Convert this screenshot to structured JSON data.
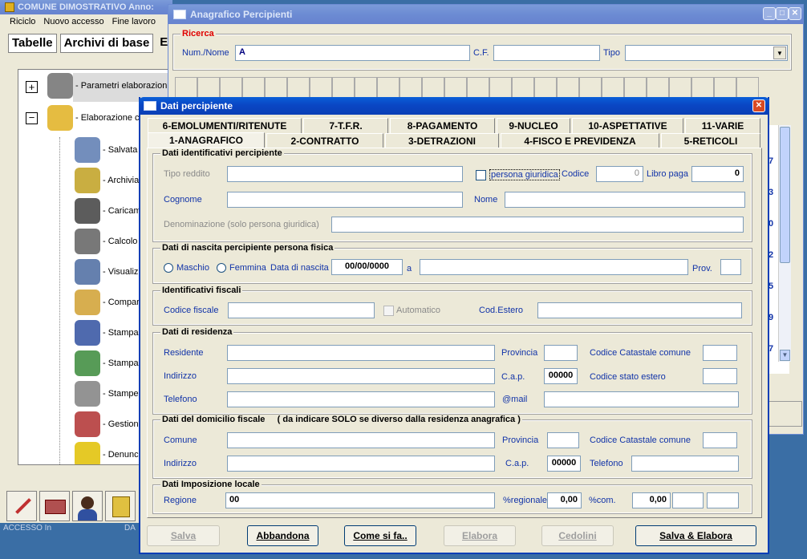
{
  "main_window": {
    "title": "COMUNE DIMOSTRATIVO  Anno:",
    "menu": [
      "Riciclo",
      "Nuovo accesso",
      "Fine lavoro"
    ],
    "tabs": [
      "Tabelle",
      "Archivi di base",
      "E"
    ],
    "tree": [
      {
        "label": "- Parametri elaborazioni",
        "icon": "gears-icon"
      },
      {
        "label": "- Elaborazione c",
        "icon": "calculator-icon"
      },
      {
        "label": "- Salvata",
        "icon": "disk-drive-icon"
      },
      {
        "label": "- Archivia",
        "icon": "keys-icon"
      },
      {
        "label": "- Caricam",
        "icon": "pen-icon"
      },
      {
        "label": "- Calcolo",
        "icon": "gear-icon"
      },
      {
        "label": "- Visualiz",
        "icon": "magnifier-document-icon"
      },
      {
        "label": "- Compar",
        "icon": "hand-documents-icon"
      },
      {
        "label": "- Stampa",
        "icon": "report-icon"
      },
      {
        "label": "- Stampa",
        "icon": "emblem-icon"
      },
      {
        "label": "- Stampe",
        "icon": "printer-icon"
      },
      {
        "label": "- Gestion",
        "icon": "checklist-icon"
      },
      {
        "label": "- Denunc",
        "icon": "pacman-icon"
      }
    ],
    "status": "ACCESSO In",
    "status2": "DA"
  },
  "anagrafico": {
    "title": "Anagrafico Percipienti",
    "ricerca_legend": "Ricerca",
    "num_nome_label": "Num./Nome",
    "num_nome_value": "A",
    "cf_label": "C.F.",
    "tipo_label": "Tipo",
    "side_numbers": [
      "7",
      "3",
      "0",
      "2",
      "5",
      "9",
      "7"
    ]
  },
  "dati": {
    "title": "Dati percipiente",
    "tabs_row1": [
      "6-EMOLUMENTI/RITENUTE",
      "7-T.F.R.",
      "8-PAGAMENTO",
      "9-NUCLEO",
      "10-ASPETTATIVE",
      "11-VARIE"
    ],
    "tabs_row2": [
      "1-ANAGRAFICO",
      "2-CONTRATTO",
      "3-DETRAZIONI",
      "4-FISCO E PREVIDENZA",
      "5-RETICOLI"
    ],
    "g1": {
      "legend": "Dati identificativi percipiente",
      "tipo_reddito": "Tipo reddito",
      "persona_giuridica": "persona giuridica",
      "codice": "Codice",
      "codice_value": "0",
      "libro_paga": "Libro paga",
      "libro_paga_value": "0",
      "cognome": "Cognome",
      "nome": "Nome",
      "denominazione": "Denominazione (solo persona giuridica)"
    },
    "g2": {
      "legend": "Dati di nascita percipiente persona fisica",
      "maschio": "Maschio",
      "femmina": "Femmina",
      "data_nascita": "Data di nascita",
      "data_value": "00/00/0000",
      "a": "a",
      "prov": "Prov."
    },
    "g3": {
      "legend": "Identificativi fiscali",
      "codice_fiscale": "Codice fiscale",
      "automatico": "Automatico",
      "cod_estero": "Cod.Estero"
    },
    "g4": {
      "legend": "Dati di residenza",
      "residente": "Residente",
      "provincia": "Provincia",
      "cod_catastale": "Codice Catastale comune",
      "indirizzo": "Indirizzo",
      "cap": "C.a.p.",
      "cap_value": "00000",
      "cod_stato": "Codice stato estero",
      "telefono": "Telefono",
      "mail": "@mail"
    },
    "g5": {
      "legend": "Dati del domicilio fiscale     ( da indicare SOLO se diverso dalla residenza anagrafica )",
      "comune": "Comune",
      "provincia": "Provincia",
      "cod_catastale": "Codice Catastale comune",
      "indirizzo": "Indirizzo",
      "cap": "C.a.p.",
      "cap_value": "00000",
      "telefono": "Telefono"
    },
    "g6": {
      "legend": "Dati Imposizione locale",
      "regione": "Regione",
      "regione_value": "00",
      "regionale": "%regionale",
      "regionale_value": "0,00",
      "com": "%com.",
      "com_value": "0,00"
    },
    "buttons": [
      "Salva",
      "Abbandona",
      "Come si fa..",
      "Elabora",
      "Cedolini",
      "Salva & Elabora"
    ]
  }
}
